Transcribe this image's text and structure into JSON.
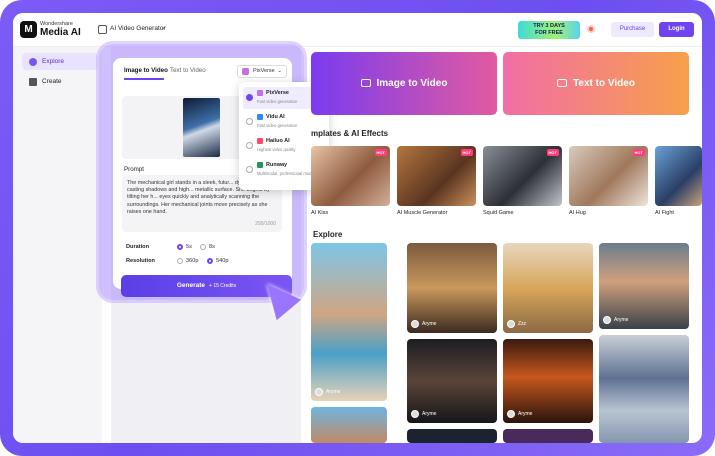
{
  "header": {
    "logo_glyph": "M",
    "brand_small": "Wondershare",
    "brand_big": "Media AI",
    "tool_name": "AI Video Generator",
    "promo_line1": "TRY 3 DAYS",
    "promo_line2": "FOR FREE",
    "purchase": "Purchase",
    "login": "Login"
  },
  "sidebar": {
    "items": [
      {
        "label": "Explore"
      },
      {
        "label": "Create"
      }
    ]
  },
  "panel": {
    "tabs": [
      "Image to Video",
      "Text to Video"
    ],
    "model": "PixVerse",
    "prompt_label": "Prompt",
    "prompt_text": "The mechanical girl stands in a sleek, futur... dynamic lighting casting shadows and high... metallic surface. She begins by tilting her h... eyes quickly and analytically scanning the surroundings. Her mechanical joints move precisely as she raises one hand.",
    "char_count": "299/1000",
    "duration_label": "Duration",
    "duration_options": [
      "5s",
      "8s"
    ],
    "resolution_label": "Resolution",
    "resolution_options": [
      "360p",
      "540p"
    ],
    "generate_label": "Generate",
    "generate_credits": "+ 15 Credits"
  },
  "dropdown": {
    "items": [
      {
        "name": "PixVerse",
        "desc": "Fast video generation",
        "color": "#c46fe8"
      },
      {
        "name": "Vidu AI",
        "desc": "Fast video generation",
        "color": "#2b8cff"
      },
      {
        "name": "Hailuo AI",
        "desc": "Highest video quality",
        "color": "#ff4a6e"
      },
      {
        "name": "Runway",
        "desc": "Multimodal, professional model",
        "color": "#1d9a5a"
      }
    ]
  },
  "main": {
    "btn_image": "Image to Video",
    "btn_text": "Text to Video",
    "templates_title": "mplates & AI Effects",
    "hot": "HOT",
    "templates": [
      {
        "name": "AI Kiss"
      },
      {
        "name": "AI Muscle Generator"
      },
      {
        "name": "Squid Game"
      },
      {
        "name": "AI Hug"
      },
      {
        "name": "AI Fight"
      }
    ],
    "explore_title": "Explore",
    "explore_users": [
      "Aryme",
      "Aryme",
      "Zzz",
      "Aryme",
      "Aryme",
      "Aryme"
    ]
  },
  "colors": {
    "accent": "#6f44f0",
    "frame": "#7c5cf5"
  }
}
